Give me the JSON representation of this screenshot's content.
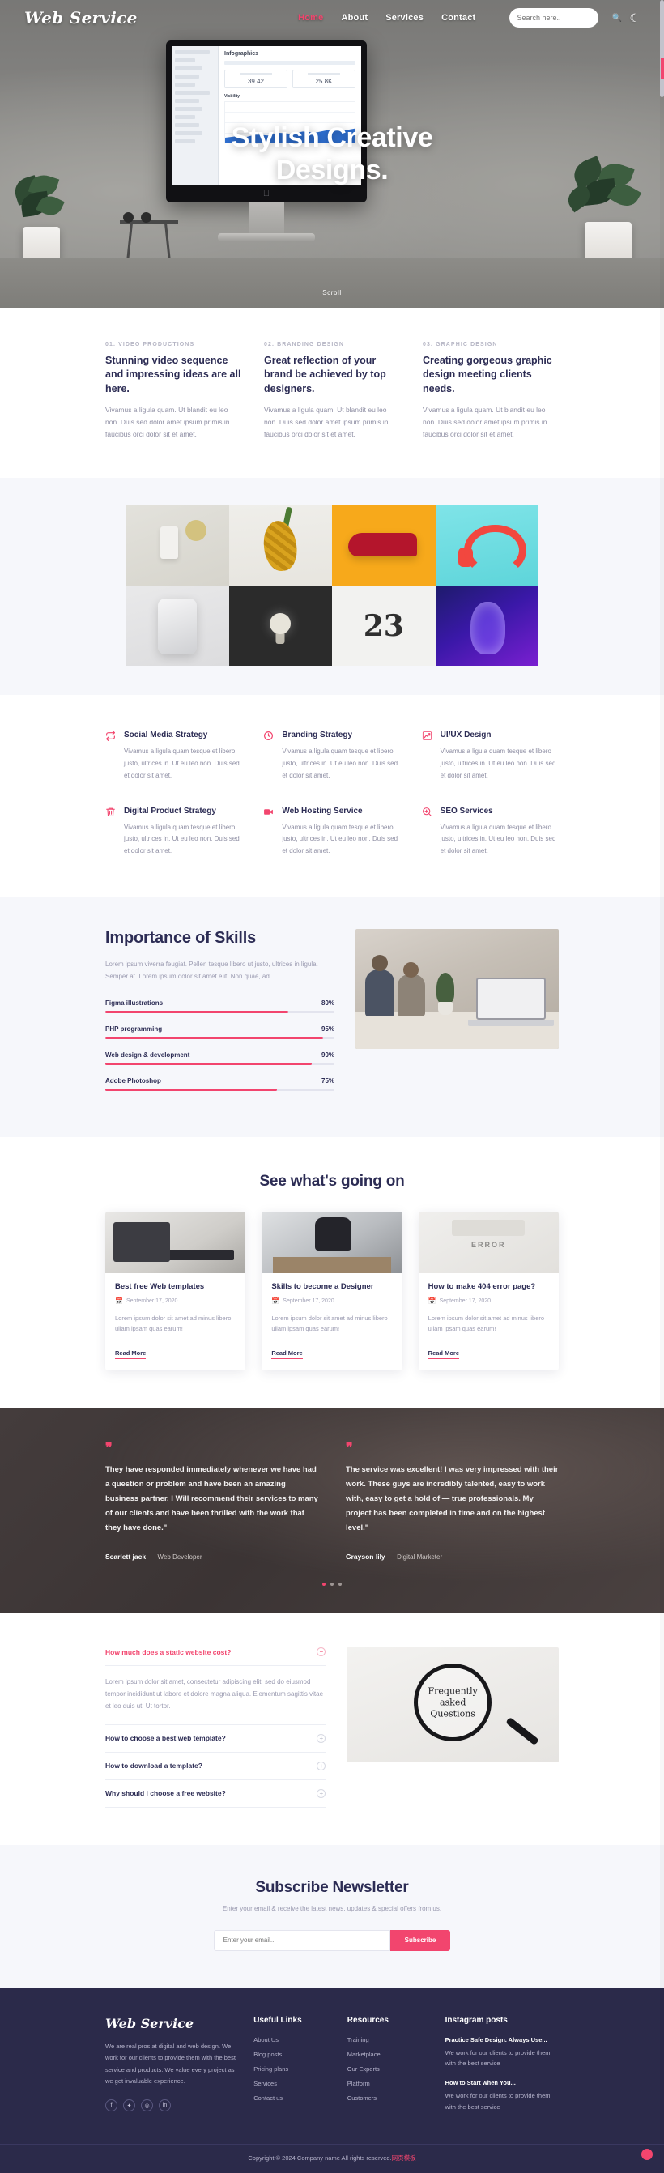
{
  "nav": {
    "brand": "Web Service",
    "links": [
      {
        "label": "Home",
        "active": true
      },
      {
        "label": "About",
        "active": false
      },
      {
        "label": "Services",
        "active": false
      },
      {
        "label": "Contact",
        "active": false
      }
    ],
    "search_placeholder": "Search here..",
    "search_value": "",
    "search_icon": "search-icon",
    "theme_toggle_icon": "moon-icon"
  },
  "hero": {
    "title_line1": "Stylish Creative",
    "title_line2": "Designs.",
    "scroll_label": "Scroll",
    "screen": {
      "title": "Infographics",
      "card1_value": "39.42",
      "card2_value": "25.8K",
      "section_label": "Visbility"
    }
  },
  "features": [
    {
      "kicker": "01. VIDEO PRODUCTIONS",
      "title": "Stunning video sequence and impressing ideas are all here.",
      "text": "Vivamus a ligula quam. Ut blandit eu leo non. Duis sed dolor amet ipsum primis in faucibus orci dolor sit et amet."
    },
    {
      "kicker": "02. BRANDING DESIGN",
      "title": "Great reflection of your brand be achieved by top designers.",
      "text": "Vivamus a ligula quam. Ut blandit eu leo non. Duis sed dolor amet ipsum primis in faucibus orci dolor sit et amet."
    },
    {
      "kicker": "03. GRAPHIC DESIGN",
      "title": "Creating gorgeous graphic design meeting clients needs.",
      "text": "Vivamus a ligula quam. Ut blandit eu leo non. Duis sed dolor amet ipsum primis in faucibus orci dolor sit et amet."
    }
  ],
  "gallery": [
    {
      "name": "gallery-item-coffee-cup"
    },
    {
      "name": "gallery-item-pineapple"
    },
    {
      "name": "gallery-item-red-sneaker"
    },
    {
      "name": "gallery-item-headphones"
    },
    {
      "name": "gallery-item-phone"
    },
    {
      "name": "gallery-item-lightbulb"
    },
    {
      "name": "gallery-item-number-23"
    },
    {
      "name": "gallery-item-blue-portrait"
    }
  ],
  "services": [
    {
      "icon": "retweet-icon",
      "title": "Social Media Strategy",
      "text": "Vivamus a ligula quam tesque et libero justo, ultrices in. Ut eu leo non. Duis sed et dolor sit amet."
    },
    {
      "icon": "clock-icon",
      "title": "Branding Strategy",
      "text": "Vivamus a ligula quam tesque et libero justo, ultrices in. Ut eu leo non. Duis sed et dolor sit amet."
    },
    {
      "icon": "chart-line-icon",
      "title": "UI/UX Design",
      "text": "Vivamus a ligula quam tesque et libero justo, ultrices in. Ut eu leo non. Duis sed et dolor sit amet."
    },
    {
      "icon": "trash-icon",
      "title": "Digital Product Strategy",
      "text": "Vivamus a ligula quam tesque et libero justo, ultrices in. Ut eu leo non. Duis sed et dolor sit amet."
    },
    {
      "icon": "video-camera-icon",
      "title": "Web Hosting Service",
      "text": "Vivamus a ligula quam tesque et libero justo, ultrices in. Ut eu leo non. Duis sed et dolor sit amet."
    },
    {
      "icon": "search-plus-icon",
      "title": "SEO Services",
      "text": "Vivamus a ligula quam tesque et libero justo, ultrices in. Ut eu leo non. Duis sed et dolor sit amet."
    }
  ],
  "skills": {
    "heading": "Importance of Skills",
    "paragraph": "Lorem ipsum viverra feugiat. Pellen tesque libero ut justo, ultrices in ligula. Semper at. Lorem ipsum dolor sit amet elit. Non quae, ad.",
    "bars": [
      {
        "name": "Figma illustrations",
        "pct": "80%",
        "value": 80
      },
      {
        "name": "PHP programming",
        "pct": "95%",
        "value": 95
      },
      {
        "name": "Web design & development",
        "pct": "90%",
        "value": 90
      },
      {
        "name": "Adobe Photoshop",
        "pct": "75%",
        "value": 75
      }
    ],
    "image_alt": "team working on laptops"
  },
  "blog": {
    "heading": "See what's going on",
    "posts": [
      {
        "title": "Best free Web templates",
        "date": "September 17, 2020",
        "text": "Lorem ipsum dolor sit amet ad minus libero ullam ipsam quas earum!",
        "more": "Read More"
      },
      {
        "title": "Skills to become a Designer",
        "date": "September 17, 2020",
        "text": "Lorem ipsum dolor sit amet ad minus libero ullam ipsam quas earum!",
        "more": "Read More"
      },
      {
        "title": "How to make 404 error page?",
        "date": "September 17, 2020",
        "text": "Lorem ipsum dolor sit amet ad minus libero ullam ipsam quas earum!",
        "more": "Read More"
      }
    ]
  },
  "testimonials": [
    {
      "quote": "They have responded immediately whenever we have had a question or problem and have been an amazing business partner. I Will recommend their services to many of our clients and have been thrilled with the work that they have done.\"",
      "name": "Scarlett jack",
      "role": "Web Developer"
    },
    {
      "quote": "The service was excellent! I was very impressed with their work. These guys are incredibly talented, easy to work with, easy to get a hold of — true professionals. My project has been completed in time and on the highest level.\"",
      "name": "Grayson lily",
      "role": "Digital Marketer"
    }
  ],
  "faq": {
    "open_question": "How much does a static website cost?",
    "open_answer": "Lorem ipsum dolor sit amet, consectetur adipiscing elit, sed do eiusmod tempor incididunt ut labore et dolore magna aliqua. Elementum sagittis vitae et leo duis ut. Ut tortor.",
    "open_sign": "−",
    "closed": [
      {
        "q": "How to choose a best web template?",
        "sign": "+"
      },
      {
        "q": "How to download a template?",
        "sign": "+"
      },
      {
        "q": "Why should i choose a free website?",
        "sign": "+"
      }
    ],
    "image_text_line1": "Frequently",
    "image_text_line2": "asked",
    "image_text_line3": "Questions"
  },
  "newsletter": {
    "heading": "Subscribe Newsletter",
    "subheading": "Enter your email & receive the latest news, updates & special offers from us.",
    "placeholder": "Enter your email...",
    "value": "",
    "button": "Subscribe"
  },
  "footer": {
    "brand": "Web Service",
    "about": "We are real pros at digital and web design. We work for our clients to provide them with the best service and products. We value every project as we get invaluable experience.",
    "social": [
      {
        "icon": "facebook-icon",
        "glyph": "f"
      },
      {
        "icon": "twitter-icon",
        "glyph": "✦"
      },
      {
        "icon": "instagram-icon",
        "glyph": "◎"
      },
      {
        "icon": "linkedin-icon",
        "glyph": "in"
      }
    ],
    "useful_links": {
      "heading": "Useful Links",
      "items": [
        "About Us",
        "Blog posts",
        "Pricing plans",
        "Services",
        "Contact us"
      ]
    },
    "resources": {
      "heading": "Resources",
      "items": [
        "Training",
        "Marketplace",
        "Our Experts",
        "Platform",
        "Customers"
      ]
    },
    "instagram": {
      "heading": "Instagram posts",
      "posts": [
        {
          "title": "Practice Safe Design. Always Use...",
          "text": "We work for our clients to provide them with the best service"
        },
        {
          "title": "How to Start when You...",
          "text": "We work for our clients to provide them with the best service"
        }
      ]
    },
    "copyright_text": "Copyright © 2024 Company name All rights reserved.",
    "copyright_link": "网页模板"
  },
  "colors": {
    "accent": "#f2456e",
    "dark": "#2c2c54",
    "footer_bg": "#2b2a4a",
    "muted": "#9a9ab0",
    "light_bg": "#f6f7fb"
  }
}
